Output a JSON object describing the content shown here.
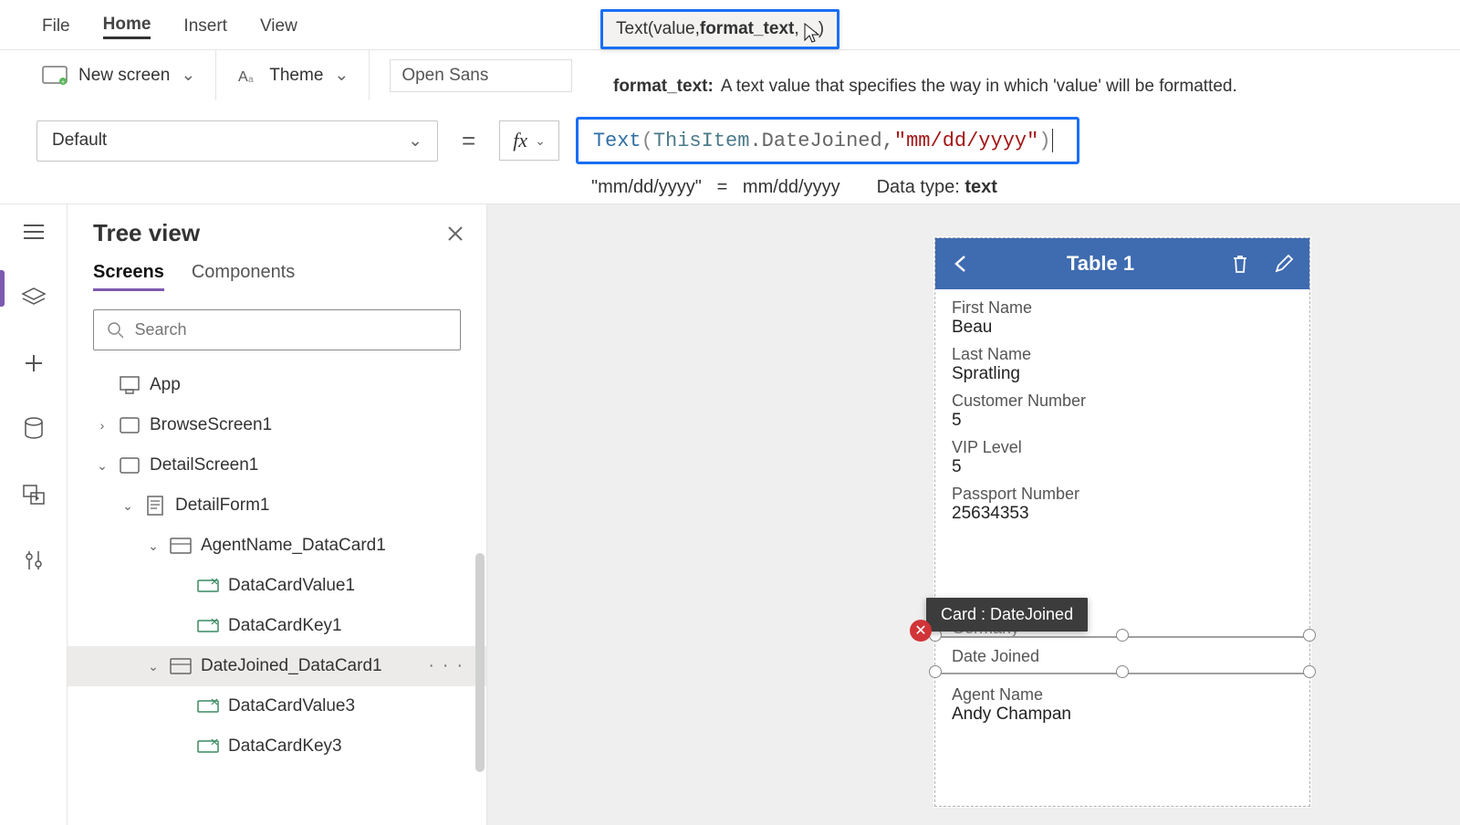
{
  "menu": {
    "file": "File",
    "home": "Home",
    "insert": "Insert",
    "view": "View"
  },
  "ribbon": {
    "new_screen": "New screen",
    "theme": "Theme",
    "font_label": "Open Sans"
  },
  "signature": {
    "prefix": "Text(value, ",
    "bold": "format_text",
    "suffix": ", ...)"
  },
  "param_help": {
    "name": "format_text:",
    "desc": "A text value that specifies the way in which 'value' will be formatted."
  },
  "property": {
    "selected": "Default"
  },
  "formula": {
    "fn": "Text",
    "open": "(",
    "obj": "ThisItem",
    "dot": ".DateJoined, ",
    "str": "\"mm/dd/yyyy\"",
    "close": ")",
    "fx_label": "fx"
  },
  "result": {
    "lhs": "\"mm/dd/yyyy\"",
    "eq": "=",
    "rhs": "mm/dd/yyyy",
    "datatype_label": "Data type:",
    "datatype_value": "text"
  },
  "tree": {
    "title": "Tree view",
    "tabs": {
      "screens": "Screens",
      "components": "Components"
    },
    "search_placeholder": "Search",
    "items": [
      {
        "depth": 0,
        "label": "App",
        "icon": "app",
        "chev": ""
      },
      {
        "depth": 0,
        "label": "BrowseScreen1",
        "icon": "screen",
        "chev": "right"
      },
      {
        "depth": 0,
        "label": "DetailScreen1",
        "icon": "screen",
        "chev": "down"
      },
      {
        "depth": 1,
        "label": "DetailForm1",
        "icon": "form",
        "chev": "down"
      },
      {
        "depth": 2,
        "label": "AgentName_DataCard1",
        "icon": "card",
        "chev": "down"
      },
      {
        "depth": 3,
        "label": "DataCardValue1",
        "icon": "input",
        "chev": ""
      },
      {
        "depth": 3,
        "label": "DataCardKey1",
        "icon": "input",
        "chev": ""
      },
      {
        "depth": 2,
        "label": "DateJoined_DataCard1",
        "icon": "card",
        "chev": "down",
        "selected": true,
        "more": true
      },
      {
        "depth": 3,
        "label": "DataCardValue3",
        "icon": "input",
        "chev": ""
      },
      {
        "depth": 3,
        "label": "DataCardKey3",
        "icon": "input",
        "chev": ""
      }
    ]
  },
  "preview": {
    "title": "Table 1",
    "fields": [
      {
        "label": "First Name",
        "value": "Beau"
      },
      {
        "label": "Last Name",
        "value": "Spratling"
      },
      {
        "label": "Customer Number",
        "value": "5"
      },
      {
        "label": "VIP Level",
        "value": "5"
      },
      {
        "label": "Passport Number",
        "value": "25634353"
      }
    ],
    "hidden_field_value": "Germany",
    "date_label": "Date Joined",
    "agent": {
      "label": "Agent Name",
      "value": "Andy Champan"
    },
    "tooltip": "Card : DateJoined",
    "error_glyph": "✕"
  }
}
